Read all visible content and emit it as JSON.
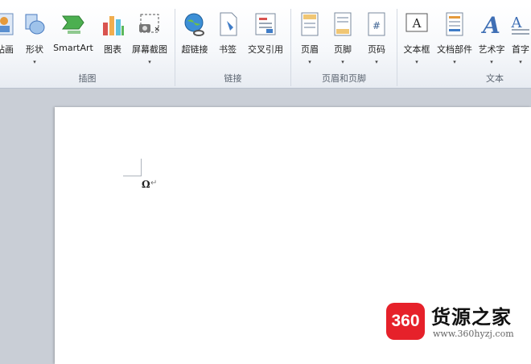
{
  "ribbon": {
    "groups": {
      "illustrations": {
        "label": "插图",
        "buttons": [
          {
            "label": "贴画",
            "has_dropdown": false
          },
          {
            "label": "形状",
            "has_dropdown": true
          },
          {
            "label": "SmartArt",
            "has_dropdown": false
          },
          {
            "label": "图表",
            "has_dropdown": false
          },
          {
            "label": "屏幕截图",
            "has_dropdown": true
          }
        ]
      },
      "links": {
        "label": "链接",
        "buttons": [
          {
            "label": "超链接",
            "has_dropdown": false
          },
          {
            "label": "书签",
            "has_dropdown": false
          },
          {
            "label": "交叉引用",
            "has_dropdown": false
          }
        ]
      },
      "header_footer": {
        "label": "页眉和页脚",
        "buttons": [
          {
            "label": "页眉",
            "has_dropdown": true
          },
          {
            "label": "页脚",
            "has_dropdown": true
          },
          {
            "label": "页码",
            "has_dropdown": true
          }
        ]
      },
      "text": {
        "label": "文本",
        "buttons": [
          {
            "label": "文本框",
            "has_dropdown": true
          },
          {
            "label": "文档部件",
            "has_dropdown": true
          },
          {
            "label": "艺术字",
            "has_dropdown": true
          },
          {
            "label": "首字",
            "has_dropdown": true
          }
        ]
      }
    }
  },
  "document": {
    "inserted_symbol": "Ω",
    "paragraph_mark": "↵"
  },
  "watermark": {
    "badge": "360",
    "title": "货源之家",
    "url": "www.360hyzj.com"
  },
  "colors": {
    "watermark_red": "#e6212a",
    "ribbon_bg": "#f6f8fb",
    "doc_bg": "#c9ced6"
  },
  "caret_glyph": "▾"
}
